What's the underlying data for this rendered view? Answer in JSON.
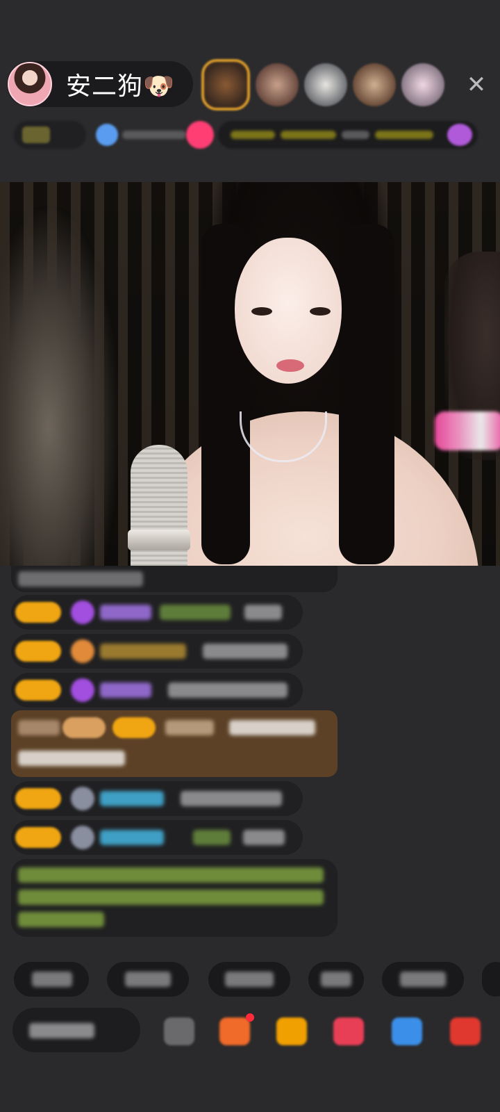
{
  "header": {
    "host_name": "安二狗🐶",
    "close_icon": "✕"
  },
  "viewers": {
    "count_shown": 5,
    "avatar_colors": [
      "#c77f2e",
      "#8a5a4c",
      "#6d6f73",
      "#8b6a54",
      "#9b8c9c"
    ]
  },
  "info_row": {
    "accent_colors": {
      "gold_bar": "#7c7419",
      "pink_dot": "#ff3e74",
      "blue_dot": "#5a9cf0",
      "purple_dot": "#b05ad9"
    }
  },
  "chat": {
    "messages": [
      {
        "type": "system",
        "colors": [
          "#8a8a8c"
        ]
      },
      {
        "type": "user",
        "badge": "gold",
        "icon": "gem-icon",
        "name_color": "#8f67c9",
        "colors": [
          "#5f7d3a",
          "#8a8a8c"
        ]
      },
      {
        "type": "user",
        "badge": "gold",
        "icon": "fan-icon",
        "name_color": "#9a7a2e",
        "colors": [
          "#8a8a8c"
        ]
      },
      {
        "type": "user",
        "badge": "gold",
        "icon": "gem-icon",
        "name_color": "#8f67c9",
        "colors": [
          "#8a8a8c"
        ]
      },
      {
        "type": "highlight",
        "colors": [
          "#a7876a",
          "#f0a612",
          "#b49a7a",
          "#d8d0c8"
        ]
      },
      {
        "type": "user",
        "badge": "gold",
        "icon": "avatar-icon",
        "name_color": "#3f9fc4",
        "colors": [
          "#8a8a8c"
        ]
      },
      {
        "type": "user",
        "badge": "gold",
        "icon": "avatar-icon",
        "name_color": "#3f9fc4",
        "colors": [
          "#5f7d3a",
          "#8a8a8c"
        ]
      },
      {
        "type": "notice",
        "colors": [
          "#6f8c3a"
        ]
      }
    ]
  },
  "quick_replies": {
    "count_shown": 6
  },
  "bottom_bar": {
    "tool_colors": [
      "#6a6a6c",
      "#f06a2a",
      "#f0a000",
      "#e83f56",
      "#3b8fe8",
      "#e0382f"
    ]
  }
}
